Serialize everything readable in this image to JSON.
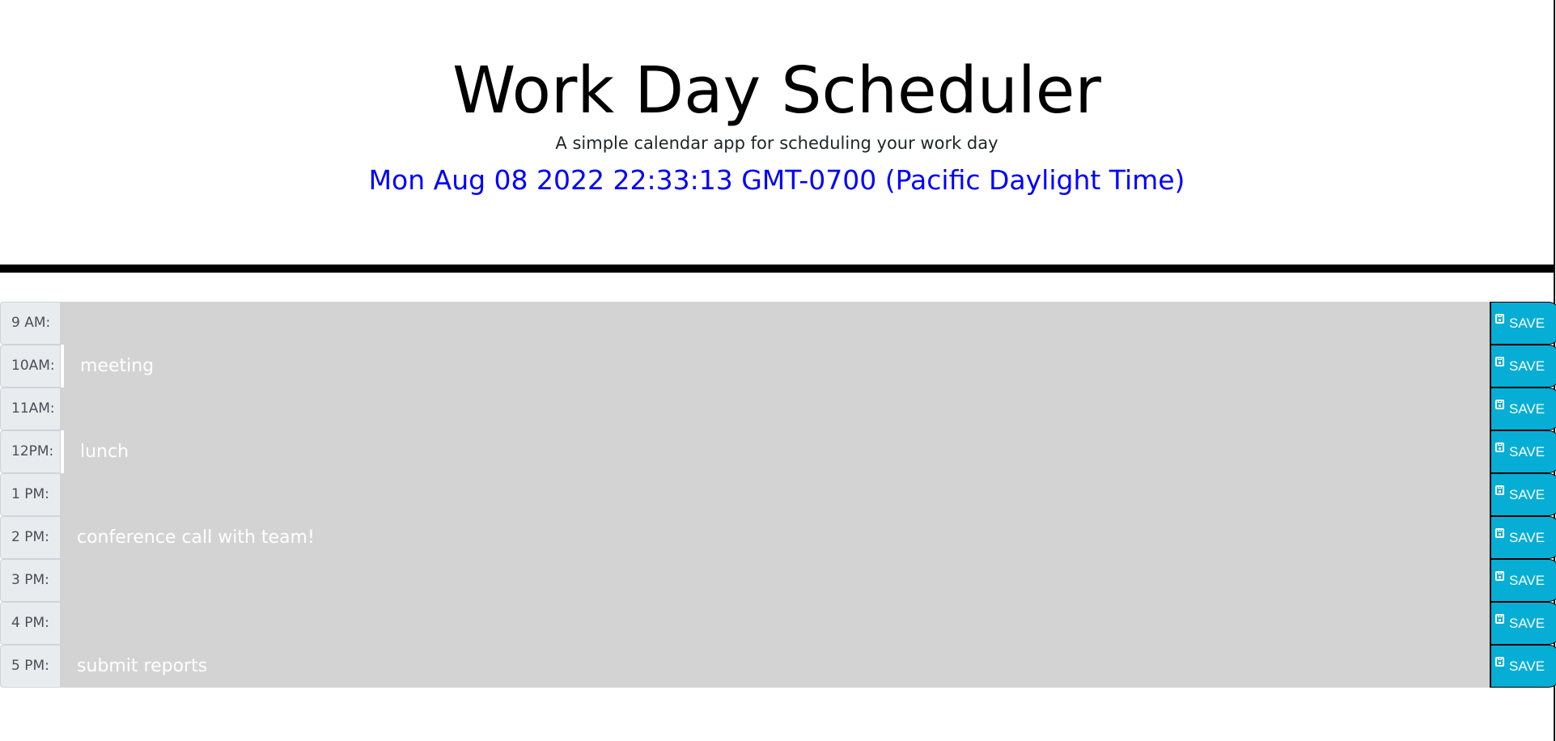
{
  "header": {
    "title": "Work Day Scheduler",
    "subtitle": "A simple calendar app for scheduling your work day",
    "current_day": "Mon Aug 08 2022 22:33:13 GMT-0700 (Pacific Daylight Time)"
  },
  "colors": {
    "current_day_text": "#0000ff",
    "past_block": "#d3d3d3",
    "save_button": "#06aed5",
    "divider": "#000000"
  },
  "save_label": "SAVE",
  "save_icon": "floppy-disk-icon",
  "time_blocks": [
    {
      "hour": "9 AM:",
      "description": ""
    },
    {
      "hour": "10AM:",
      "description": "meeting"
    },
    {
      "hour": "11AM:",
      "description": ""
    },
    {
      "hour": "12PM:",
      "description": "lunch"
    },
    {
      "hour": "1 PM:",
      "description": ""
    },
    {
      "hour": "2 PM:",
      "description": "conference call with team!"
    },
    {
      "hour": "3 PM:",
      "description": ""
    },
    {
      "hour": "4 PM:",
      "description": ""
    },
    {
      "hour": "5 PM:",
      "description": "submit reports"
    }
  ]
}
